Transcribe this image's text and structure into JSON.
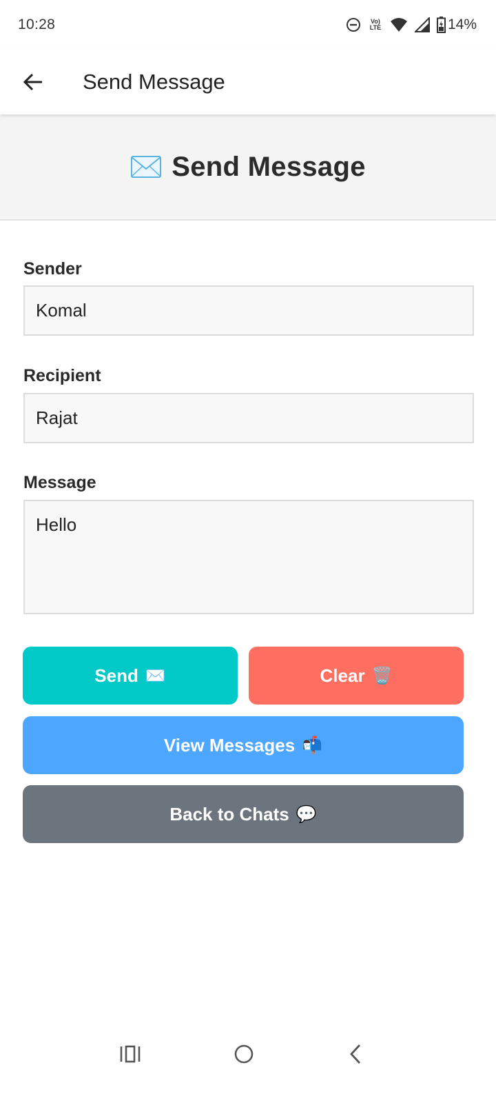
{
  "status_bar": {
    "time": "10:28",
    "network_label": "Vo)) LTE",
    "battery": "14%"
  },
  "app_bar": {
    "title": "Send Message",
    "back_icon": "arrow-left-icon"
  },
  "header": {
    "icon": "envelope-icon",
    "title": "Send Message"
  },
  "form": {
    "sender": {
      "label": "Sender",
      "value": "Komal"
    },
    "recipient": {
      "label": "Recipient",
      "value": "Rajat"
    },
    "message": {
      "label": "Message",
      "value": "Hello"
    }
  },
  "buttons": {
    "send": {
      "label": "Send",
      "emoji": "✉️",
      "color": "#00c9c8"
    },
    "clear": {
      "label": "Clear",
      "emoji": "🗑️",
      "color": "#ff6f61"
    },
    "view_messages": {
      "label": "View Messages",
      "emoji": "📬",
      "color": "#4da6ff"
    },
    "back_to_chats": {
      "label": "Back to Chats",
      "emoji": "💬",
      "color": "#6c757d"
    }
  },
  "nav_bar": {
    "recents_icon": "recents-icon",
    "home_icon": "home-icon",
    "back_icon": "back-chevron-icon"
  }
}
